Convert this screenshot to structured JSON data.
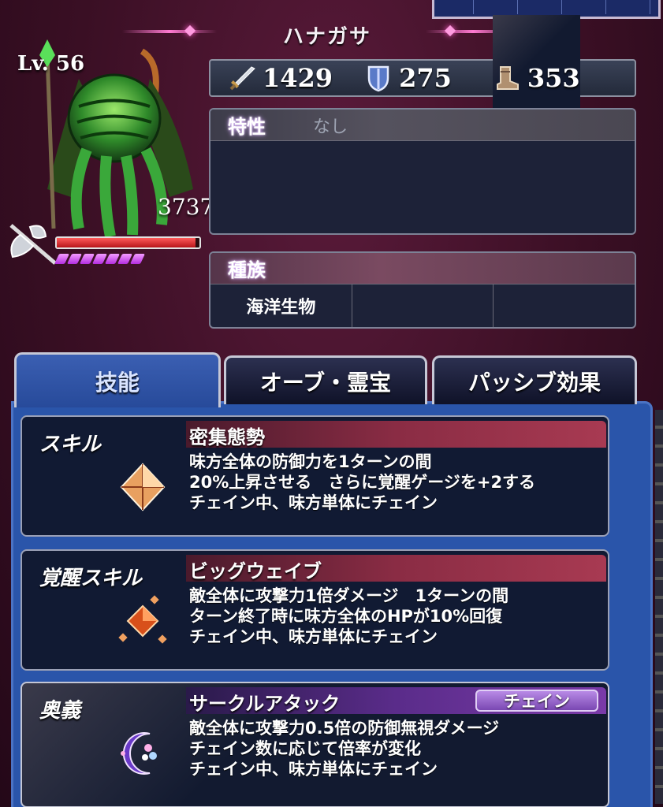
{
  "header": {
    "title": "ハナガサ"
  },
  "unit": {
    "level": "Lv. 56",
    "hp": "3737",
    "hp_fraction": 0.97,
    "mp_pips": 7
  },
  "stats": {
    "attack": "1429",
    "defense": "275",
    "speed": "353"
  },
  "traits": {
    "label": "特性",
    "value": "なし"
  },
  "race": {
    "label": "種族",
    "cells": [
      "海洋生物",
      "",
      ""
    ]
  },
  "tabs": [
    {
      "label": "技能"
    },
    {
      "label": "オーブ・霊宝"
    },
    {
      "label": "パッシブ効果"
    }
  ],
  "skills": [
    {
      "category": "スキル",
      "name": "密集態勢",
      "lines": [
        "味方全体の防御力を1ターンの間",
        "20%上昇させる　さらに覚醒ゲージを+2する",
        "チェイン中、味方単体にチェイン"
      ]
    },
    {
      "category": "覚醒スキル",
      "name": "ビッグウェイブ",
      "lines": [
        "敵全体に攻撃力1倍ダメージ　1ターンの間",
        "ターン終了時に味方全体のHPが10%回復",
        "チェイン中、味方単体にチェイン"
      ]
    },
    {
      "category": "奥義",
      "name": "サークルアタック",
      "badge": "チェイン",
      "lines": [
        "敵全体に攻撃力0.5倍の防御無視ダメージ",
        "チェイン数に応じて倍率が変化",
        "チェイン中、味方単体にチェイン"
      ]
    }
  ],
  "colors": {
    "accent_tab": "#2a55aa",
    "hp_bar": "#d82a30",
    "mp_pip": "#c84ae8"
  }
}
